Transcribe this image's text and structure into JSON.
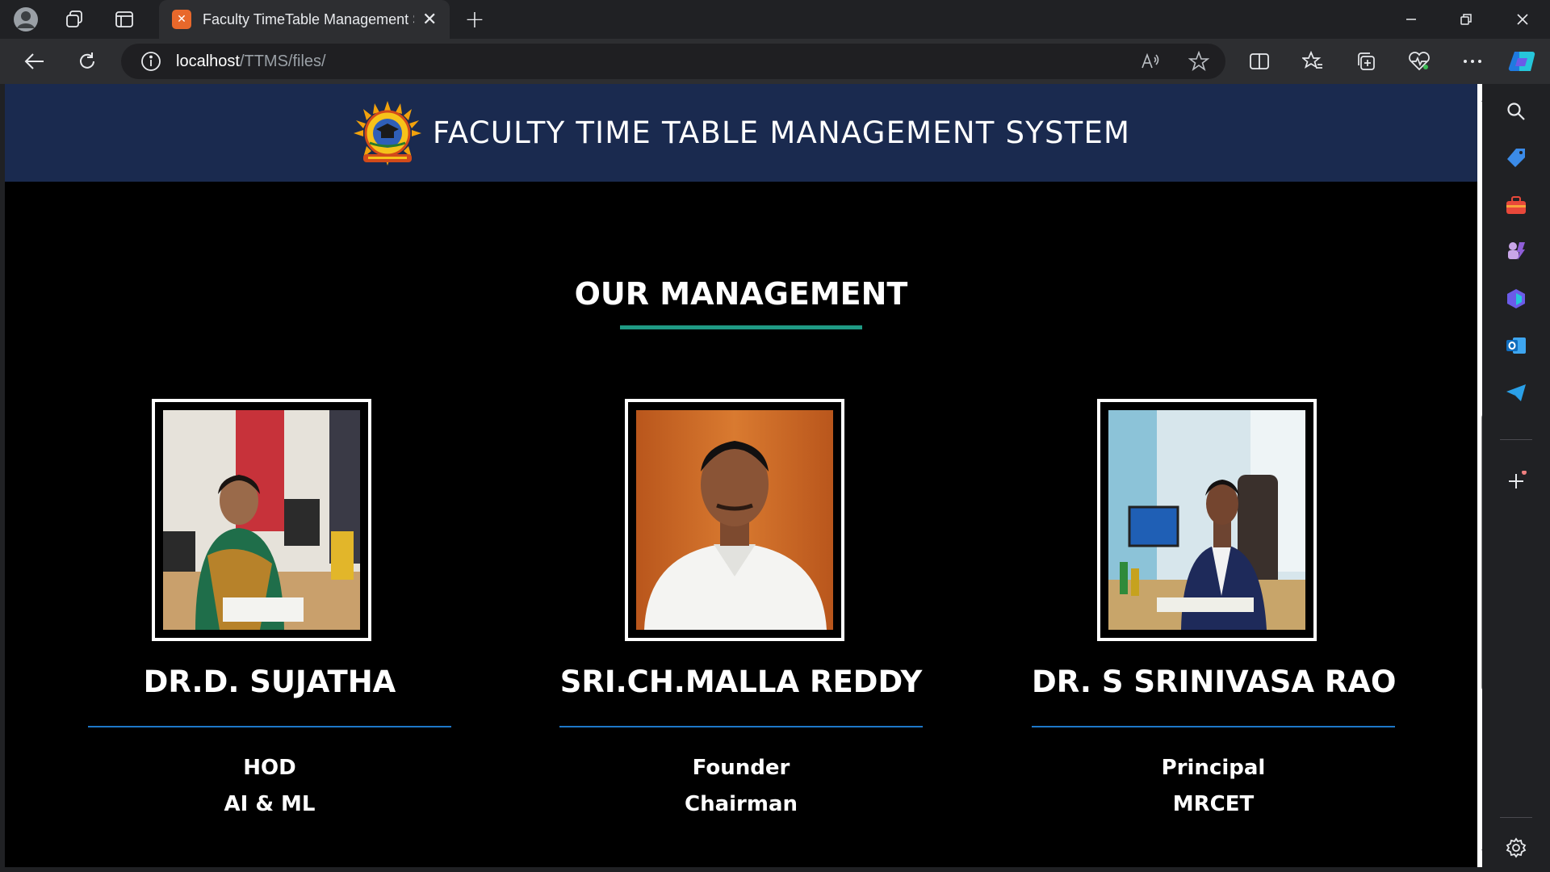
{
  "browser": {
    "tab_title": "Faculty TimeTable Management S",
    "address_host": "localhost",
    "address_path": "/TTMS/files/"
  },
  "site": {
    "title": "FACULTY TIME TABLE MANAGEMENT SYSTEM",
    "section_title": "OUR MANAGEMENT"
  },
  "people": [
    {
      "name": "DR.D. SUJATHA",
      "role_line1": "HOD",
      "role_line2": "AI & ML"
    },
    {
      "name": "SRI.CH.MALLA REDDY",
      "role_line1": "Founder",
      "role_line2": "Chairman"
    },
    {
      "name": "DR. S SRINIVASA RAO",
      "role_line1": "Principal",
      "role_line2": "MRCET"
    }
  ],
  "colors": {
    "header_bg": "#1a2a4f",
    "title_underline": "#1f9a84",
    "name_underline": "#1e78c8",
    "page_bg": "#000000"
  }
}
